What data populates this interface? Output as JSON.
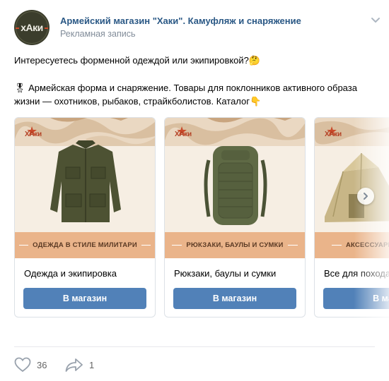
{
  "post": {
    "author": "Армейский магазин \"Хаки\". Камуфляж и снаряжение",
    "subtitle": "Рекламная запись",
    "avatar_text": "хАки",
    "line1": "Интересуетесь форменной одеждой или экипировкой?🤔",
    "line2": "🎖 Армейская форма и снаряжение. Товары для поклонников активного образа жизни — охотников, рыбаков, страйкболистов. Каталог👇",
    "logo_text": "ХАки"
  },
  "cards": [
    {
      "banner": "ОДЕЖДА В СТИЛЕ МИЛИТАРИ",
      "title": "Одежда и экипировка",
      "button": "В магазин",
      "icon": "jacket-image"
    },
    {
      "banner": "РЮКЗАКИ, БАУЛЫ И СУМКИ",
      "title": "Рюкзаки, баулы и сумки",
      "button": "В магазин",
      "icon": "backpack-image"
    },
    {
      "banner": "АКСЕССУАРЫ Д",
      "title": "Все для похода",
      "button": "В маг",
      "icon": "tent-image"
    }
  ],
  "actions": {
    "likes": "36",
    "shares": "1"
  },
  "colors": {
    "link": "#2a5885",
    "button": "#5181b8",
    "banner": "#eab48a",
    "card_bg": "#f6eee3"
  }
}
